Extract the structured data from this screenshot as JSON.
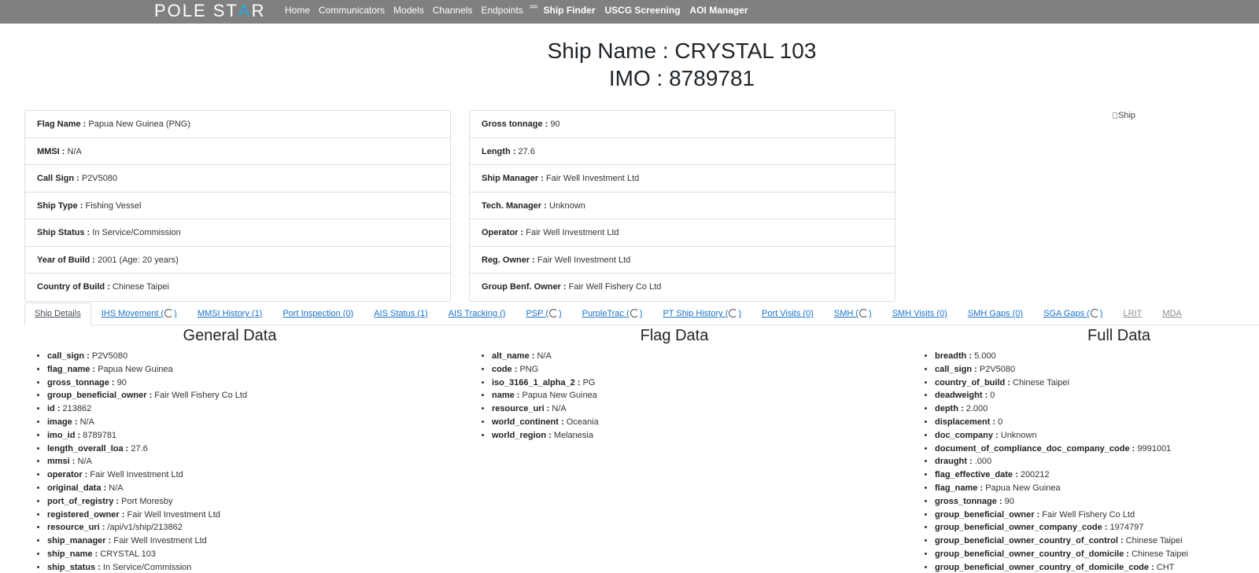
{
  "navbar": {
    "brand_part1": "POLE ST",
    "brand_accent": "A",
    "brand_part2": "R",
    "plain_links": [
      "Home",
      "Communicators",
      "Models",
      "Channels",
      "Endpoints"
    ],
    "menu_glyph": "==",
    "bold_links": [
      "Ship Finder",
      "USCG Screening",
      "AOI Manager"
    ]
  },
  "header": {
    "ship_name": "Ship Name : CRYSTAL 103",
    "imo": "IMO : 8789781"
  },
  "details_left": [
    {
      "label": "Flag Name :",
      "value": " Papua New Guinea (PNG)"
    },
    {
      "label": "MMSI :",
      "value": " N/A"
    },
    {
      "label": "Call Sign :",
      "value": " P2V5080"
    },
    {
      "label": "Ship Type :",
      "value": " Fishing Vessel"
    },
    {
      "label": "Ship Status :",
      "value": " In Service/Commission"
    },
    {
      "label": "Year of Build :",
      "value": " 2001 (Age: 20 years)"
    },
    {
      "label": "Country of Build :",
      "value": " Chinese Taipei"
    }
  ],
  "details_right": [
    {
      "label": "Gross tonnage :",
      "value": " 90"
    },
    {
      "label": "Length :",
      "value": " 27.6"
    },
    {
      "label": "Ship Manager :",
      "value": " Fair Well Investment Ltd"
    },
    {
      "label": "Tech. Manager :",
      "value": " Unknown"
    },
    {
      "label": "Operator :",
      "value": " Fair Well Investment Ltd"
    },
    {
      "label": "Reg. Owner :",
      "value": " Fair Well Investment Ltd"
    },
    {
      "label": "Group Benf. Owner :",
      "value": " Fair Well Fishery Co Ltd"
    }
  ],
  "ship_image_alt": "Ship",
  "tabs": [
    {
      "pre": "Ship Details",
      "post": "",
      "spinner": false,
      "state": "active"
    },
    {
      "pre": "IHS Movement (",
      "post": ")",
      "spinner": true,
      "state": "link"
    },
    {
      "pre": "MMSI History (1)",
      "post": "",
      "spinner": false,
      "state": "link"
    },
    {
      "pre": "Port Inspection (0)",
      "post": "",
      "spinner": false,
      "state": "link"
    },
    {
      "pre": "AIS Status (1)",
      "post": "",
      "spinner": false,
      "state": "link"
    },
    {
      "pre": "AIS Tracking ()",
      "post": "",
      "spinner": false,
      "state": "link"
    },
    {
      "pre": "PSP (",
      "post": ")",
      "spinner": true,
      "state": "link"
    },
    {
      "pre": "PurpleTrac (",
      "post": ")",
      "spinner": true,
      "state": "link"
    },
    {
      "pre": "PT Ship History (",
      "post": ")",
      "spinner": true,
      "state": "link"
    },
    {
      "pre": "Port Visits (0)",
      "post": "",
      "spinner": false,
      "state": "link"
    },
    {
      "pre": "SMH (",
      "post": ")",
      "spinner": true,
      "state": "link"
    },
    {
      "pre": "SMH Visits (0)",
      "post": "",
      "spinner": false,
      "state": "link"
    },
    {
      "pre": "SMH Gaps (0)",
      "post": "",
      "spinner": false,
      "state": "link"
    },
    {
      "pre": "SGA Gaps (",
      "post": ")",
      "spinner": true,
      "state": "link"
    },
    {
      "pre": "LRIT",
      "post": "",
      "spinner": false,
      "state": "disabled"
    },
    {
      "pre": "MDA",
      "post": "",
      "spinner": false,
      "state": "disabled"
    }
  ],
  "general_data": {
    "title": "General Data",
    "items": [
      {
        "key": "call_sign :",
        "value": " P2V5080"
      },
      {
        "key": "flag_name :",
        "value": " Papua New Guinea"
      },
      {
        "key": "gross_tonnage :",
        "value": " 90"
      },
      {
        "key": "group_beneficial_owner :",
        "value": " Fair Well Fishery Co Ltd"
      },
      {
        "key": "id :",
        "value": " 213862"
      },
      {
        "key": "image :",
        "value": " N/A"
      },
      {
        "key": "imo_id :",
        "value": " 8789781"
      },
      {
        "key": "length_overall_loa :",
        "value": " 27.6"
      },
      {
        "key": "mmsi :",
        "value": " N/A"
      },
      {
        "key": "operator :",
        "value": " Fair Well Investment Ltd"
      },
      {
        "key": "original_data :",
        "value": " N/A"
      },
      {
        "key": "port_of_registry :",
        "value": " Port Moresby"
      },
      {
        "key": "registered_owner :",
        "value": " Fair Well Investment Ltd"
      },
      {
        "key": "resource_uri :",
        "value": " /api/v1/ship/213862"
      },
      {
        "key": "ship_manager :",
        "value": " Fair Well Investment Ltd"
      },
      {
        "key": "ship_name :",
        "value": " CRYSTAL 103"
      },
      {
        "key": "ship_status :",
        "value": " In Service/Commission"
      }
    ]
  },
  "flag_data": {
    "title": "Flag Data",
    "items": [
      {
        "key": "alt_name :",
        "value": " N/A"
      },
      {
        "key": "code :",
        "value": " PNG"
      },
      {
        "key": "iso_3166_1_alpha_2 :",
        "value": " PG"
      },
      {
        "key": "name :",
        "value": " Papua New Guinea"
      },
      {
        "key": "resource_uri :",
        "value": " N/A"
      },
      {
        "key": "world_continent :",
        "value": " Oceania"
      },
      {
        "key": "world_region :",
        "value": " Melanesia"
      }
    ]
  },
  "full_data": {
    "title": "Full Data",
    "items": [
      {
        "key": "breadth :",
        "value": " 5.000"
      },
      {
        "key": "call_sign :",
        "value": " P2V5080"
      },
      {
        "key": "country_of_build :",
        "value": " Chinese Taipei"
      },
      {
        "key": "deadweight :",
        "value": " 0"
      },
      {
        "key": "depth :",
        "value": " 2.000"
      },
      {
        "key": "displacement :",
        "value": " 0"
      },
      {
        "key": "doc_company :",
        "value": " Unknown"
      },
      {
        "key": "document_of_compliance_doc_company_code :",
        "value": " 9991001"
      },
      {
        "key": "draught :",
        "value": " .000"
      },
      {
        "key": "flag_effective_date :",
        "value": " 200212"
      },
      {
        "key": "flag_name :",
        "value": " Papua New Guinea"
      },
      {
        "key": "gross_tonnage :",
        "value": " 90"
      },
      {
        "key": "group_beneficial_owner :",
        "value": " Fair Well Fishery Co Ltd"
      },
      {
        "key": "group_beneficial_owner_company_code :",
        "value": " 1974797"
      },
      {
        "key": "group_beneficial_owner_country_of_control :",
        "value": " Chinese Taipei"
      },
      {
        "key": "group_beneficial_owner_country_of_domicile :",
        "value": " Chinese Taipei"
      },
      {
        "key": "group_beneficial_owner_country_of_domicile_code :",
        "value": " CHT"
      }
    ]
  },
  "colors": {
    "navbar_bg": "#808080",
    "brand_accent": "#2aa7d6",
    "tab_link": "#1a73c9"
  }
}
